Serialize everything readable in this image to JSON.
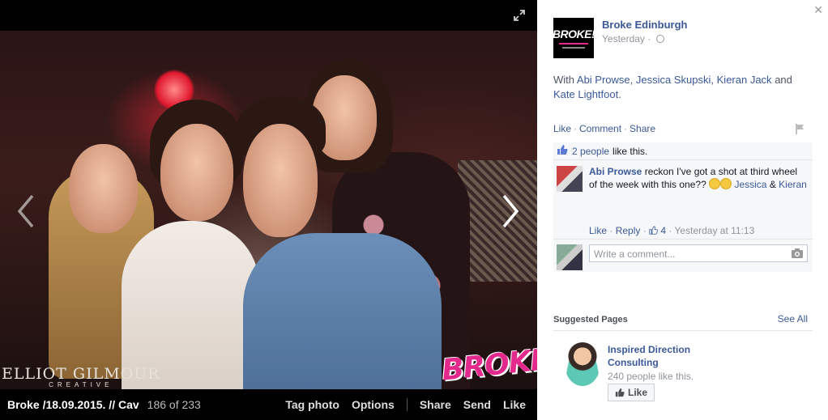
{
  "photo": {
    "credit_main": "ELLIOT GILMOUR",
    "credit_sub": "CREATIVE",
    "stamp": "BROKE!"
  },
  "photo_bar": {
    "album_title": "Broke /18.09.2015. // Cav",
    "counter": "186 of 233",
    "tag_photo": "Tag photo",
    "options": "Options",
    "share": "Share",
    "send": "Send",
    "like": "Like"
  },
  "post": {
    "page_thumb_text": "BROKE!",
    "page_name": "Broke Edinburgh",
    "time": "Yesterday",
    "with_prefix": "With",
    "tagged": [
      "Abi Prowse",
      "Jessica Skupski",
      "Kieran Jack",
      "Kate Lightfoot"
    ],
    "sep1": ",",
    "sep2": ",",
    "and_word": "and",
    "period": "."
  },
  "actions": {
    "like": "Like",
    "comment": "Comment",
    "share": "Share"
  },
  "ufi": {
    "likes_count": "2 people",
    "likes_text": "like this.",
    "comment": {
      "author": "Abi Prowse",
      "text": "reckon I've got a shot at third wheel of the week with this one??",
      "mention1": "Jessica",
      "amp": "&",
      "mention2": "Kieran",
      "like_label": "Like",
      "reply_label": "Reply",
      "like_count": "4",
      "timestamp": "Yesterday at 11:13"
    },
    "write_placeholder": "Write a comment..."
  },
  "suggested": {
    "title": "Suggested Pages",
    "see_all": "See All",
    "page_name": "Inspired Direction Consulting",
    "page_likes": "240 people like this.",
    "like_button": "Like"
  },
  "colors": {
    "link_blue": "#3b5998",
    "photo_bg": "#000000",
    "stamp_pink": "#e32a8c"
  },
  "icons": [
    "expand-icon",
    "close-icon",
    "prev-arrow-icon",
    "next-arrow-icon",
    "globe-icon",
    "flag-icon",
    "like-thumb-icon",
    "camera-icon"
  ]
}
